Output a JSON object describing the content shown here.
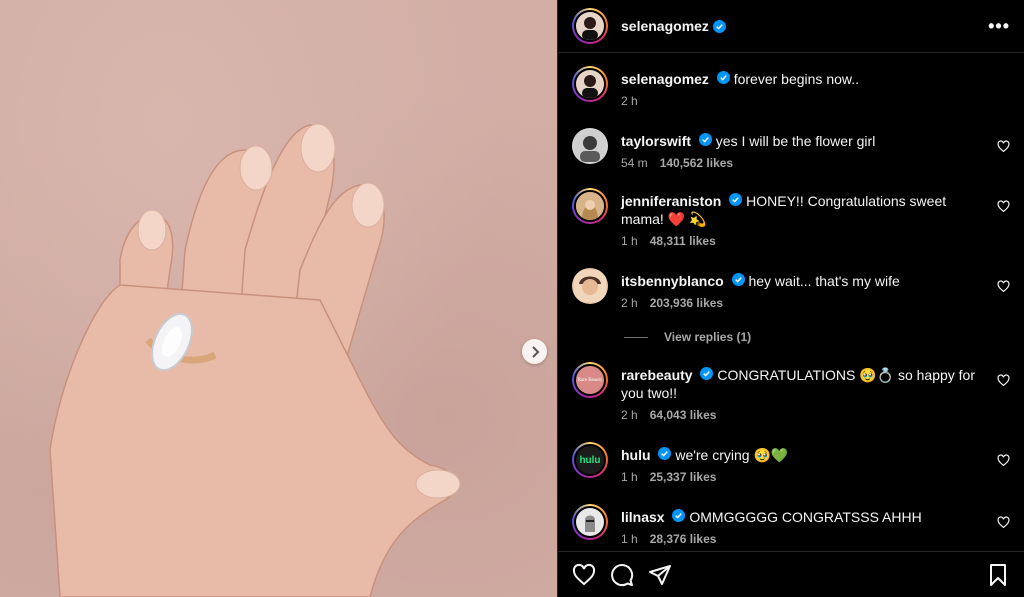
{
  "post": {
    "author": "selenagomez",
    "caption": "forever begins now..",
    "caption_time": "2 h"
  },
  "header": {
    "more_label": "•••"
  },
  "comments": [
    {
      "user": "taylorswift",
      "verified": true,
      "text": "yes I will be the flower girl",
      "time": "54 m",
      "likes": "140,562 likes"
    },
    {
      "user": "jenniferaniston",
      "verified": true,
      "text": "HONEY!! Congratulations sweet mama! ❤️ 💫",
      "time": "1 h",
      "likes": "48,311 likes"
    },
    {
      "user": "itsbennyblanco",
      "verified": true,
      "text": "hey wait... that's my wife",
      "time": "2 h",
      "likes": "203,936 likes"
    },
    {
      "user": "rarebeauty",
      "verified": true,
      "text": "CONGRATULATIONS 🥹💍 so happy for you two!!",
      "time": "2 h",
      "likes": "64,043 likes"
    },
    {
      "user": "hulu",
      "verified": true,
      "text": "we're crying 🥹💚",
      "time": "1 h",
      "likes": "25,337 likes"
    },
    {
      "user": "lilnasx",
      "verified": true,
      "text": "OMMGGGGG CONGRATSSS AHHH",
      "time": "1 h",
      "likes": "28,376 likes"
    }
  ],
  "view_replies": "View replies (1)",
  "avatar_labels": {
    "rarebeauty": "Rare Beauty",
    "hulu": "hulu"
  },
  "colors": {
    "verified": "#0095f6",
    "background": "#000000",
    "muted": "#a8a8a8"
  },
  "icons": [
    "heart-icon",
    "comment-icon",
    "share-icon",
    "bookmark-icon",
    "chevron-right-icon",
    "more-icon",
    "verified-badge-icon"
  ]
}
